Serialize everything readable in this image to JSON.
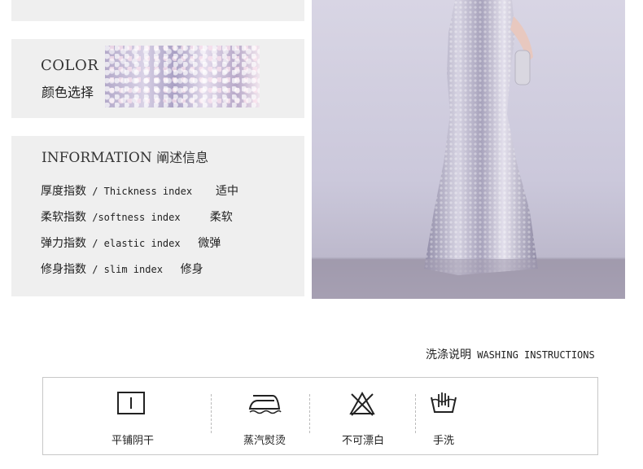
{
  "color_panel": {
    "title_en": "COLOR",
    "title_cn": "颜色选择"
  },
  "info_panel": {
    "title_en": "INFORMATION",
    "title_cn": "阐述信息",
    "rows": [
      {
        "label_cn": "厚度指数",
        "label_en": " / Thickness index    ",
        "value": "适中"
      },
      {
        "label_cn": "柔软指数",
        "label_en": " /softness index     ",
        "value": "柔软"
      },
      {
        "label_cn": "弹力指数",
        "label_en": " / elastic index   ",
        "value": "微弹"
      },
      {
        "label_cn": "修身指数",
        "label_en": " / slim index   ",
        "value": "修身"
      }
    ]
  },
  "washing": {
    "title_cn": "洗涤说明",
    "title_en": " WASHING INSTRUCTIONS",
    "items": [
      {
        "label": "平铺阴干",
        "icon": "flat-dry-icon"
      },
      {
        "label": "蒸汽熨烫",
        "icon": "steam-iron-icon"
      },
      {
        "label": "不可漂白",
        "icon": "no-bleach-icon"
      },
      {
        "label": "手洗",
        "icon": "hand-wash-icon"
      }
    ]
  },
  "colors": {
    "panel_bg": "#efefef",
    "dress_silver": "#b9b6c8"
  }
}
